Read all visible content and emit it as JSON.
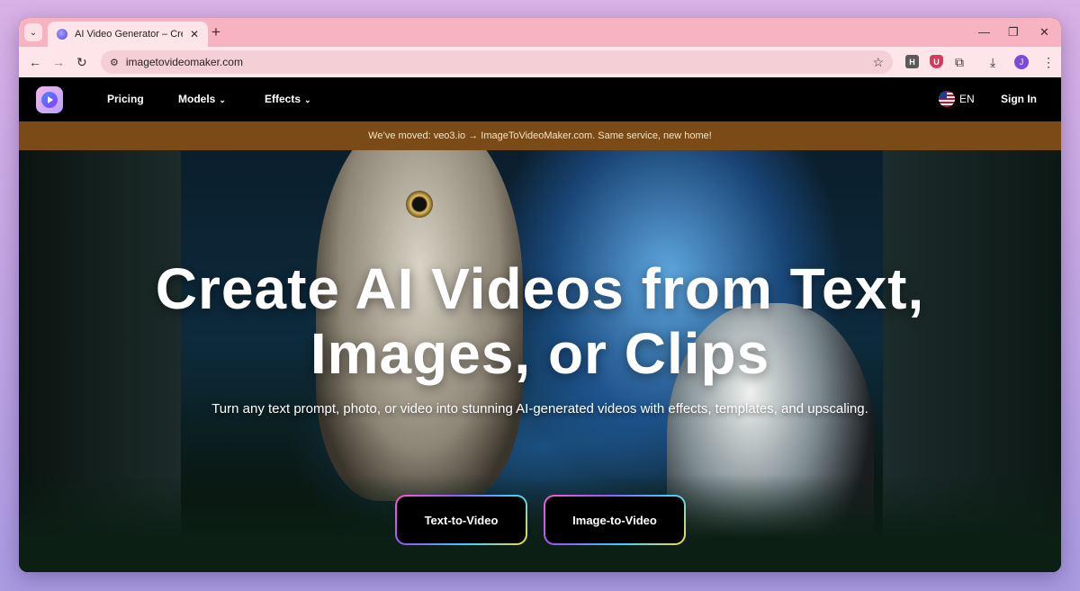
{
  "browser": {
    "tab": {
      "title": "AI Video Generator – Create Vid"
    },
    "url": "imagetovideomaker.com",
    "profile_initial": "J",
    "extensions": [
      {
        "name": "h-extension-icon",
        "label": "H",
        "color": "#5a5a5a"
      },
      {
        "name": "shield-extension-icon",
        "label": "U",
        "color": "#d43a5a"
      }
    ]
  },
  "site": {
    "nav": {
      "pricing": "Pricing",
      "models": "Models",
      "effects": "Effects",
      "language": "EN",
      "signin": "Sign In"
    },
    "banner": "We’ve moved: veo3.io → ImageToVideoMaker.com. Same service, new home!",
    "hero": {
      "title_line1": "Create AI Videos from Text,",
      "title_line2": "Images, or Clips",
      "subtitle": "Turn any text prompt, photo, or video into stunning AI-generated videos with effects, templates, and upscaling.",
      "cta_primary": "Text-to-Video",
      "cta_secondary": "Image-to-Video"
    }
  },
  "colors": {
    "tabstrip": "#f7b3c0",
    "toolbar": "#fde5ea",
    "banner": "#7a4a17",
    "nav": "#000000"
  }
}
